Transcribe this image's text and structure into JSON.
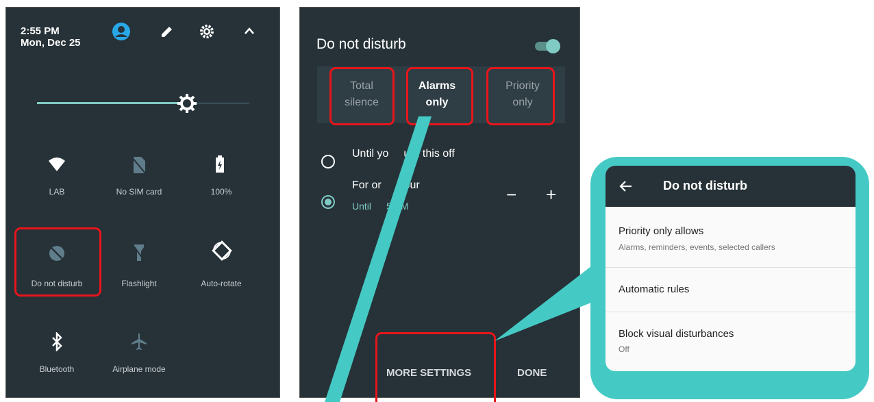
{
  "quick_settings": {
    "time": "2:55 PM",
    "date": "Mon, Dec 25",
    "tiles": [
      {
        "label": "LAB",
        "icon": "wifi-icon"
      },
      {
        "label": "No SIM card",
        "icon": "no-sim-icon"
      },
      {
        "label": "100%",
        "icon": "battery-charging-icon"
      },
      {
        "label": "Do not disturb",
        "icon": "do-not-disturb-icon"
      },
      {
        "label": "Flashlight",
        "icon": "flashlight-icon"
      },
      {
        "label": "Auto-rotate",
        "icon": "auto-rotate-icon"
      },
      {
        "label": "Bluetooth",
        "icon": "bluetooth-icon"
      },
      {
        "label": "Airplane mode",
        "icon": "airplane-icon"
      }
    ],
    "brightness_level": 0.7
  },
  "dnd_dialog": {
    "title": "Do not disturb",
    "toggle_on": true,
    "modes": [
      {
        "line1": "Total",
        "line2": "silence"
      },
      {
        "line1": "Alarms",
        "line2": "only",
        "selected": true
      },
      {
        "line1": "Priority",
        "line2": "only"
      }
    ],
    "option1": "Until yo",
    "option1_b": "urn this off",
    "option2": "For or",
    "option2_b": "hour",
    "option2_sub_a": "Until",
    "option2_sub_b": "5 PM",
    "minus": "−",
    "plus": "+",
    "more_settings": "MORE SETTINGS",
    "done": "DONE"
  },
  "settings_screen": {
    "title": "Do not disturb",
    "items": [
      {
        "title": "Priority only allows",
        "subtitle": "Alarms, reminders, events, selected callers"
      },
      {
        "title": "Automatic rules",
        "subtitle": ""
      },
      {
        "title": "Block visual disturbances",
        "subtitle": "Off"
      }
    ]
  },
  "colors": {
    "panel_bg": "#263238",
    "accent": "#80cbc4",
    "highlight_red": "#e8151b",
    "callout_teal": "#45c9c4"
  }
}
